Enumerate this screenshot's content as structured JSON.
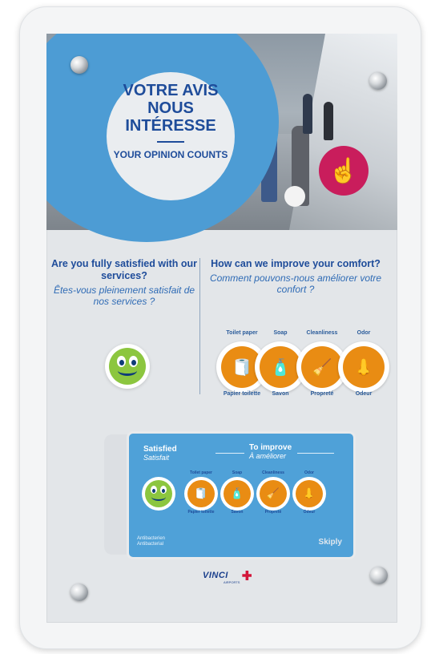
{
  "header": {
    "title_fr": "VOTRE AVIS NOUS INTÉRESSE",
    "title_en": "YOUR OPINION COUNTS"
  },
  "left_question": {
    "en": "Are you fully satisfied with our services?",
    "fr": "Êtes-vous pleinement satisfait de nos services ?"
  },
  "right_question": {
    "en": "How can we improve your comfort?",
    "fr": "Comment pouvons-nous améliorer votre confort ?"
  },
  "options": [
    {
      "en": "Toilet paper",
      "fr": "Papier toilette",
      "icon": "toilet-paper-icon",
      "glyph": "🧻"
    },
    {
      "en": "Soap",
      "fr": "Savon",
      "icon": "soap-icon",
      "glyph": "🧴"
    },
    {
      "en": "Cleanliness",
      "fr": "Propreté",
      "icon": "cleaning-icon",
      "glyph": "🧹"
    },
    {
      "en": "Odor",
      "fr": "Odeur",
      "icon": "nose-icon",
      "glyph": "👃"
    }
  ],
  "device": {
    "satisfied_en": "Satisfied",
    "satisfied_fr": "Satisfait",
    "improve_en": "To improve",
    "improve_fr": "À améliorer",
    "antibac_1": "Antibacterien",
    "antibac_2": "Antibacterial",
    "brand": "Skiply"
  },
  "logo": {
    "name": "VINCI",
    "sub": "AIRPORTS"
  },
  "colors": {
    "blue": "#4d9cd4",
    "navy": "#1e4c9a",
    "orange": "#e98c13",
    "green": "#8cc63f",
    "magenta": "#c91d5c"
  }
}
